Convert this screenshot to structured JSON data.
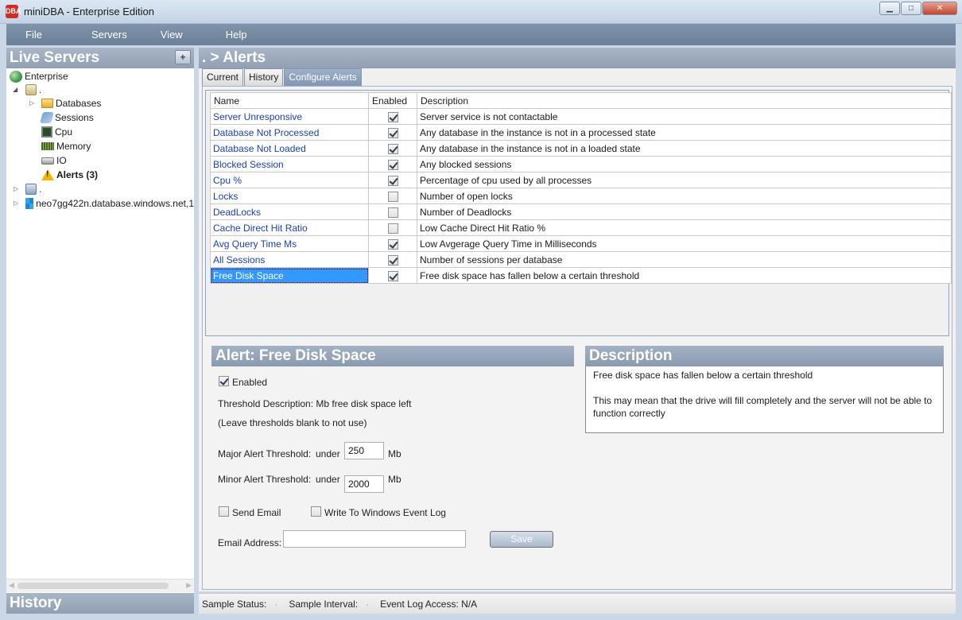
{
  "window": {
    "title": "miniDBA - Enterprise Edition",
    "icon_text": "DBA",
    "buttons": {
      "minimize": "▁",
      "maximize": "□",
      "close": "✕"
    }
  },
  "menu": [
    "File",
    "Servers",
    "View",
    "Help"
  ],
  "left": {
    "title": "Live Servers",
    "add_label": "+",
    "tree": {
      "root": "Enterprise",
      "server1": ".",
      "databases": "Databases",
      "sessions": "Sessions",
      "cpu": "Cpu",
      "memory": "Memory",
      "io": "IO",
      "alerts": "Alerts (3)",
      "server2": ".",
      "server3": "neo7gg422n.database.windows.net,1"
    },
    "history_title": "History"
  },
  "main": {
    "breadcrumb": ". > Alerts",
    "tabs": [
      "Current",
      "History",
      "Configure Alerts"
    ],
    "active_tab": "Configure Alerts",
    "grid": {
      "headers": [
        "Name",
        "Enabled",
        "Description"
      ],
      "rows": [
        {
          "name": "Server Unresponsive",
          "enabled": true,
          "description": "Server service is not contactable"
        },
        {
          "name": "Database Not Processed",
          "enabled": true,
          "description": "Any database in the instance is not in a processed state"
        },
        {
          "name": "Database Not Loaded",
          "enabled": true,
          "description": "Any database in the instance is not in a loaded state"
        },
        {
          "name": "Blocked Session",
          "enabled": true,
          "description": "Any blocked sessions"
        },
        {
          "name": "Cpu %",
          "enabled": true,
          "description": "Percentage of cpu used by all processes"
        },
        {
          "name": "Locks",
          "enabled": false,
          "description": "Number of open locks"
        },
        {
          "name": "DeadLocks",
          "enabled": false,
          "description": "Number of Deadlocks"
        },
        {
          "name": "Cache Direct Hit Ratio",
          "enabled": false,
          "description": "Low Cache Direct Hit Ratio %"
        },
        {
          "name": "Avg Query Time Ms",
          "enabled": true,
          "description": "Low Avgerage Query Time in Milliseconds"
        },
        {
          "name": "All Sessions",
          "enabled": true,
          "description": "Number of sessions per database"
        },
        {
          "name": "Free Disk Space",
          "enabled": true,
          "description": "Free disk space has fallen below a certain threshold",
          "selected": true
        }
      ]
    },
    "alert_detail": {
      "title": "Alert: Free Disk Space",
      "enabled_label": "Enabled",
      "enabled": true,
      "threshold_description": "Threshold Description: Mb free disk space left",
      "threshold_note": "(Leave thresholds blank to not use)",
      "major_label": "Major Alert Threshold:",
      "major_op": "under",
      "major_value": "250",
      "major_unit": "Mb",
      "minor_label": "Minor Alert Threshold:",
      "minor_op": "under",
      "minor_value": "2000",
      "minor_unit": "Mb",
      "send_email_label": "Send Email",
      "send_email": false,
      "event_log_label": "Write To Windows Event Log",
      "event_log": false,
      "email_label": "Email Address:",
      "email_value": "",
      "save_label": "Save"
    },
    "description_panel": {
      "title": "Description",
      "line1": "Free disk space has fallen below a certain threshold",
      "line2": "This may mean that the drive will fill completely and the server will not be able to function correctly"
    }
  },
  "status": {
    "sample_status": "Sample Status:",
    "sample_interval": "Sample Interval:",
    "event_log_access": "Event Log Access: N/A"
  }
}
